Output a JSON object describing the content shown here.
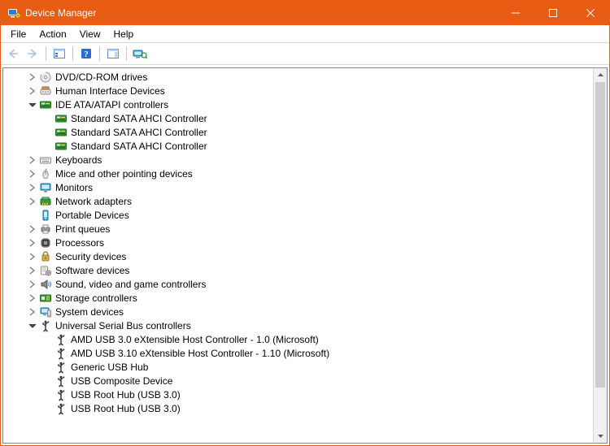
{
  "colors": {
    "accent": "#e85c14"
  },
  "window": {
    "title": "Device Manager"
  },
  "menu": {
    "file": "File",
    "action": "Action",
    "view": "View",
    "help": "Help"
  },
  "toolbar": {
    "back": "Back",
    "forward": "Forward",
    "show_hide_tree": "Show/Hide Console Tree",
    "help": "Help",
    "show_hide_action": "Show/Hide Action Pane",
    "scan": "Scan for hardware changes"
  },
  "tree": [
    {
      "depth": 1,
      "expander": "collapsed",
      "icon": "disc",
      "label": "DVD/CD-ROM drives"
    },
    {
      "depth": 1,
      "expander": "collapsed",
      "icon": "hid",
      "label": "Human Interface Devices"
    },
    {
      "depth": 1,
      "expander": "expanded",
      "icon": "ide",
      "label": "IDE ATA/ATAPI controllers"
    },
    {
      "depth": 2,
      "expander": "none",
      "icon": "ide",
      "label": "Standard SATA AHCI Controller"
    },
    {
      "depth": 2,
      "expander": "none",
      "icon": "ide",
      "label": "Standard SATA AHCI Controller"
    },
    {
      "depth": 2,
      "expander": "none",
      "icon": "ide",
      "label": "Standard SATA AHCI Controller"
    },
    {
      "depth": 1,
      "expander": "collapsed",
      "icon": "keyboard",
      "label": "Keyboards"
    },
    {
      "depth": 1,
      "expander": "collapsed",
      "icon": "mouse",
      "label": "Mice and other pointing devices"
    },
    {
      "depth": 1,
      "expander": "collapsed",
      "icon": "monitor",
      "label": "Monitors"
    },
    {
      "depth": 1,
      "expander": "collapsed",
      "icon": "network",
      "label": "Network adapters"
    },
    {
      "depth": 1,
      "expander": "none",
      "icon": "portable",
      "label": "Portable Devices"
    },
    {
      "depth": 1,
      "expander": "collapsed",
      "icon": "printer",
      "label": "Print queues"
    },
    {
      "depth": 1,
      "expander": "collapsed",
      "icon": "cpu",
      "label": "Processors"
    },
    {
      "depth": 1,
      "expander": "collapsed",
      "icon": "security",
      "label": "Security devices"
    },
    {
      "depth": 1,
      "expander": "collapsed",
      "icon": "software",
      "label": "Software devices"
    },
    {
      "depth": 1,
      "expander": "collapsed",
      "icon": "audio",
      "label": "Sound, video and game controllers"
    },
    {
      "depth": 1,
      "expander": "collapsed",
      "icon": "storage",
      "label": "Storage controllers"
    },
    {
      "depth": 1,
      "expander": "collapsed",
      "icon": "system",
      "label": "System devices"
    },
    {
      "depth": 1,
      "expander": "expanded",
      "icon": "usb",
      "label": "Universal Serial Bus controllers"
    },
    {
      "depth": 2,
      "expander": "none",
      "icon": "usb",
      "label": "AMD USB 3.0 eXtensible Host Controller - 1.0 (Microsoft)"
    },
    {
      "depth": 2,
      "expander": "none",
      "icon": "usb",
      "label": "AMD USB 3.10 eXtensible Host Controller - 1.10 (Microsoft)"
    },
    {
      "depth": 2,
      "expander": "none",
      "icon": "usb",
      "label": "Generic USB Hub"
    },
    {
      "depth": 2,
      "expander": "none",
      "icon": "usb",
      "label": "USB Composite Device"
    },
    {
      "depth": 2,
      "expander": "none",
      "icon": "usb",
      "label": "USB Root Hub (USB 3.0)"
    },
    {
      "depth": 2,
      "expander": "none",
      "icon": "usb",
      "label": "USB Root Hub (USB 3.0)"
    }
  ]
}
